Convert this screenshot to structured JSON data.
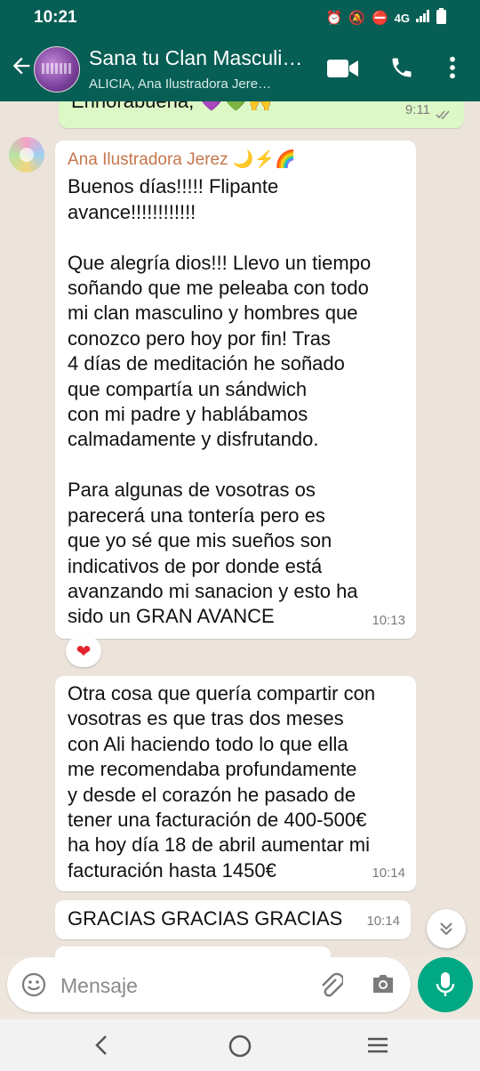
{
  "status_bar": {
    "time": "10:21",
    "network": "4G"
  },
  "header": {
    "title": "Sana tu Clan Masculi…",
    "subtitle": "ALICIA, Ana Ilustradora Jere…"
  },
  "messages": {
    "prev_outgoing": {
      "text": "Enhorabuena, 💜💚🙌",
      "time": "9:11"
    },
    "msg1": {
      "sender": "Ana Ilustradora Jerez 🌙⚡🌈",
      "text": "Buenos días!!!!! Flipante\navance!!!!!!!!!!!!\n\nQue alegría dios!!! Llevo un tiempo\nsoñando que me peleaba con todo\nmi clan masculino y hombres que\nconozco pero hoy por fin! Tras\n4 días de meditación he soñado\nque compartía un sándwich\ncon mi padre y hablábamos\ncalmadamente y disfrutando.\n\nPara algunas de vosotras os\nparecerá una tontería pero es\nque yo sé que mis sueños son\nindicativos de por donde está\navanzando mi sanacion y esto ha\nsido un GRAN AVANCE",
      "time": "10:13",
      "reaction": "❤"
    },
    "msg2": {
      "text": "Otra cosa que quería compartir con\nvosotras es que tras dos meses\ncon Ali haciendo todo lo que ella\nme recomendaba profundamente\ny desde el corazón he pasado de\ntener una facturación de 400-500€\nha hoy día 18 de abril aumentar mi\nfacturación hasta 1450€",
      "time": "10:14"
    },
    "msg3": {
      "text": "GRACIAS GRACIAS GRACIAS",
      "time": "10:14"
    }
  },
  "input": {
    "placeholder": "Mensaje"
  },
  "colors": {
    "header": "#075e54",
    "accent": "#00a884",
    "sender_name": "#c5764b",
    "chat_bg": "#ece4db",
    "outgoing_bubble": "#dcf8c6"
  }
}
